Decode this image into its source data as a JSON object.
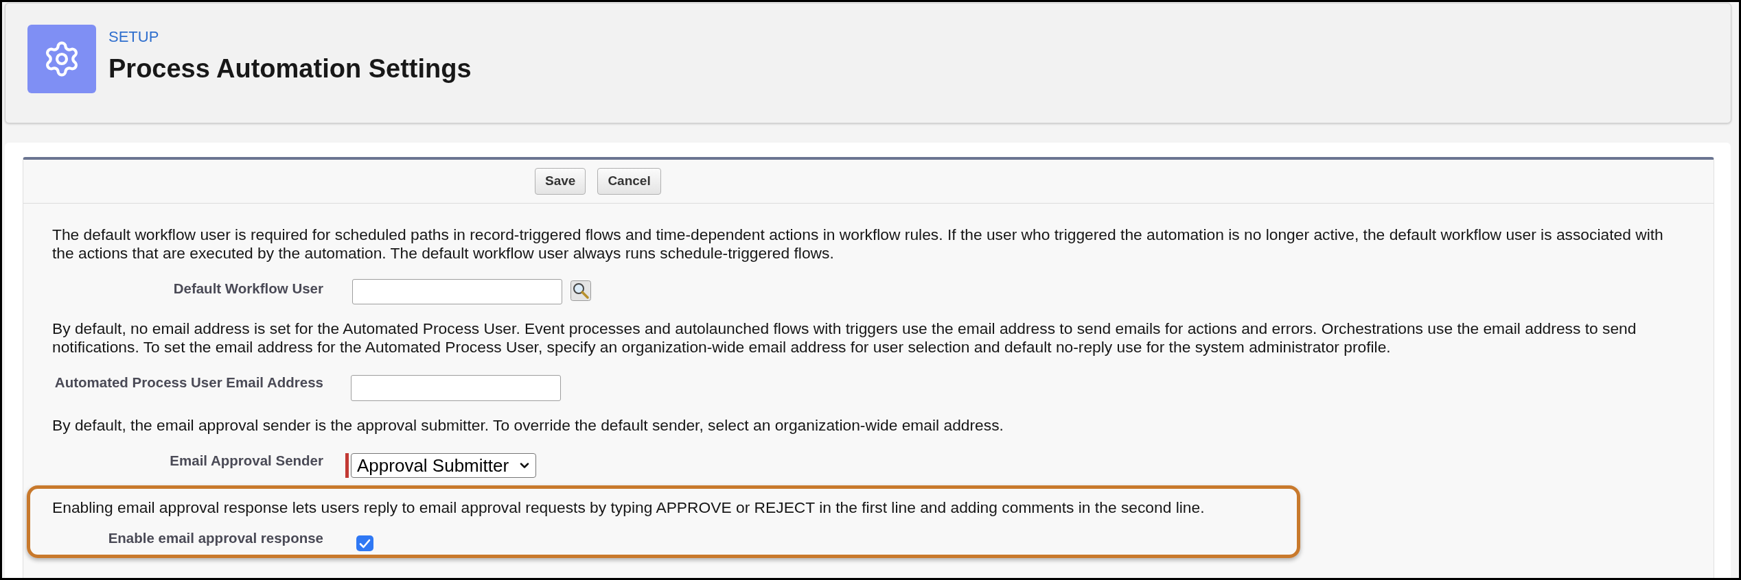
{
  "header": {
    "breadcrumb": "SETUP",
    "title": "Process Automation Settings"
  },
  "buttons": [
    "Save",
    "Cancel"
  ],
  "sections": [
    {
      "description": "The default workflow user is required for scheduled paths in record-triggered flows and time-dependent actions in workflow rules. If the user who triggered the automation is no longer active, the default workflow user is associated with the actions that are executed by the automation. The default workflow user always runs schedule-triggered flows.",
      "highlighted": false,
      "field": {
        "kind": "lookup",
        "label": "Default Workflow User"
      }
    },
    {
      "description": "By default, no email address is set for the Automated Process User. Event processes and autolaunched flows with triggers use the email address to send emails for actions and errors. Orchestrations use the email address to send notifications. To set the email address for the Automated Process User, specify an organization-wide email address for user selection and default no-reply use for the system administrator profile.",
      "highlighted": false,
      "field": {
        "kind": "text",
        "label": "Automated Process User Email Address"
      }
    },
    {
      "description": "By default, the email approval sender is the approval submitter. To override the default sender, select an organization-wide email address.",
      "highlighted": false,
      "field": {
        "kind": "select",
        "label": "Email Approval Sender",
        "value": "Approval Submitter",
        "required": true
      }
    },
    {
      "description": "Enabling email approval response lets users reply to email approval requests by typing APPROVE or REJECT in the first line and adding comments in the second line.",
      "highlighted": true,
      "field": {
        "kind": "checkbox",
        "label": "Enable email approval response",
        "checked": true
      }
    }
  ]
}
